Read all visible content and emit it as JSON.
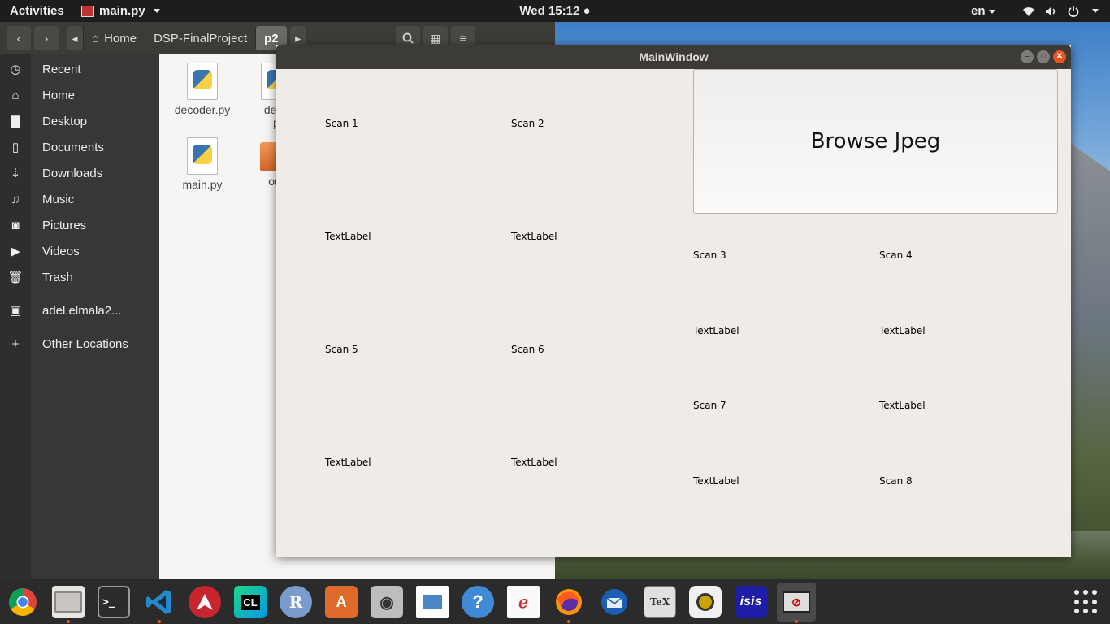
{
  "topbar": {
    "activities": "Activities",
    "app_menu": "main.py",
    "clock": "Wed 15:12",
    "lang": "en"
  },
  "files": {
    "breadcrumbs": [
      "Home",
      "DSP-FinalProject",
      "p2"
    ],
    "sidebar": [
      {
        "label": "Recent",
        "icon": "clock-icon"
      },
      {
        "label": "Home",
        "icon": "home-icon"
      },
      {
        "label": "Desktop",
        "icon": "folder-icon"
      },
      {
        "label": "Documents",
        "icon": "document-icon"
      },
      {
        "label": "Downloads",
        "icon": "download-icon"
      },
      {
        "label": "Music",
        "icon": "music-icon"
      },
      {
        "label": "Pictures",
        "icon": "camera-icon"
      },
      {
        "label": "Videos",
        "icon": "video-icon"
      },
      {
        "label": "Trash",
        "icon": "trash-icon"
      },
      {
        "label": "adel.elmala2...",
        "icon": "network-drive-icon"
      },
      {
        "label": "Other Locations",
        "icon": "plus-icon"
      }
    ],
    "items": [
      {
        "name": "decoder.py"
      },
      {
        "name": "deco",
        "line2": "p"
      },
      {
        "name": "main.py"
      },
      {
        "name": "out"
      }
    ]
  },
  "mainwindow": {
    "title": "MainWindow",
    "browse_button": "Browse Jpeg",
    "labels": {
      "scan1": "Scan 1",
      "scan2": "Scan 2",
      "text1": "TextLabel",
      "text2": "TextLabel",
      "scan3": "Scan 3",
      "scan4": "Scan 4",
      "text3": "TextLabel",
      "text4": "TextLabel",
      "scan5": "Scan 5",
      "scan6": "Scan 6",
      "scan7": "Scan 7",
      "text8": "TextLabel",
      "text5": "TextLabel",
      "text6": "TextLabel",
      "text7": "TextLabel",
      "scan8": "Scan 8"
    }
  },
  "dock": {
    "apps": [
      "chrome-icon",
      "files-icon",
      "terminal-icon",
      "vscode-icon",
      "arch-icon",
      "clion-icon",
      "r-icon",
      "software-center-icon",
      "camera-icon",
      "document-viewer-icon",
      "help-icon",
      "evince-icon",
      "firefox-icon",
      "thunderbird-icon",
      "texmaker-icon",
      "speaker-icon",
      "isis-icon",
      "python-app-icon"
    ],
    "labels": {
      "clion": "CL",
      "r": "R",
      "help": "?",
      "isis": "isis",
      "texmaker": "TeX"
    }
  }
}
